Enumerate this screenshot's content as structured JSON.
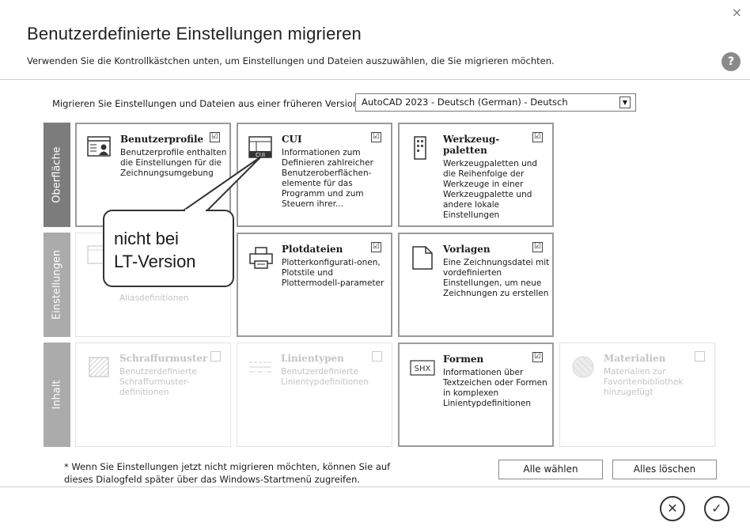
{
  "dialog": {
    "title": "Benutzerdefinierte Einstellungen migrieren",
    "subtitle": "Verwenden Sie die Kontrollkästchen unten, um Einstellungen und Dateien auszuwählen, die Sie migrieren möchten.",
    "close_glyph": "×",
    "help_glyph": "?"
  },
  "version": {
    "label": "Migrieren Sie Einstellungen und Dateien aus einer früheren Version:",
    "selected": "AutoCAD 2023 - Deutsch (German) - Deutsch",
    "arrow": "▼"
  },
  "rows": [
    {
      "label": "Oberfläche"
    },
    {
      "label": "Einstellungen"
    },
    {
      "label": "Inhalt"
    }
  ],
  "cards": {
    "benutzerprofile": {
      "title": "Benutzerprofile",
      "desc": "Benutzerprofile enthalten die Einstellungen für die Zeichnungsumgebung",
      "checked": true,
      "icon": "user-profile-icon"
    },
    "cui": {
      "title": "CUI",
      "desc": "Informationen zum Definieren zahlreicher Benutzeroberflächen-elemente für das Programm und zum Steuern ihrer...",
      "checked": true,
      "icon": "cui-icon",
      "icon_text": "CUI"
    },
    "werkzeugpaletten": {
      "title": "Werkzeug-paletten",
      "desc": "Werkzeugpaletten und die Reihenfolge der Werkzeuge in einer Werkzeugpalette und andere lokale Einstellungen",
      "checked": true,
      "icon": "tool-palette-icon"
    },
    "aliase": {
      "title": "",
      "desc": "Aliasdefinitionen",
      "checked": false,
      "icon": "alias-icon"
    },
    "plotdateien": {
      "title": "Plotdateien",
      "desc": "Plotterkonfigurati-onen, Plotstile und Plottermodell-parameter",
      "checked": true,
      "icon": "printer-icon"
    },
    "vorlagen": {
      "title": "Vorlagen",
      "desc": "Eine Zeichnungsdatei mit vordefinierten Einstellungen, um neue Zeichnungen zu erstellen",
      "checked": true,
      "icon": "template-file-icon"
    },
    "schraffurmuster": {
      "title": "Schraffurmuster",
      "desc": "Benutzerdefinierte Schraffurmuster-definitionen",
      "checked": false,
      "icon": "hatch-pattern-icon"
    },
    "linientypen": {
      "title": "Linientypen",
      "desc": "Benutzerdefinierte Linientypdefinitionen",
      "checked": false,
      "icon": "linetype-icon"
    },
    "formen": {
      "title": "Formen",
      "desc": "Informationen über Textzeichen oder Formen in komplexen Linientypdefinitionen",
      "checked": true,
      "icon": "shx-icon",
      "icon_text": "SHX"
    },
    "materialien": {
      "title": "Materialien",
      "desc": "Materialien zur Favoritenbibliothek hinzugefügt",
      "checked": false,
      "icon": "material-sphere-icon"
    }
  },
  "check_glyph": "☑",
  "callout": {
    "line1": "nicht bei",
    "line2": "LT-Version"
  },
  "footer": {
    "note_line1": "* Wenn Sie Einstellungen jetzt nicht migrieren möchten, können Sie auf",
    "note_line2": "dieses Dialogfeld später über das Windows-Startmenü zugreifen.",
    "select_all": "Alle wählen",
    "clear_all": "Alles löschen",
    "cancel_glyph": "✕",
    "ok_glyph": "✓"
  }
}
